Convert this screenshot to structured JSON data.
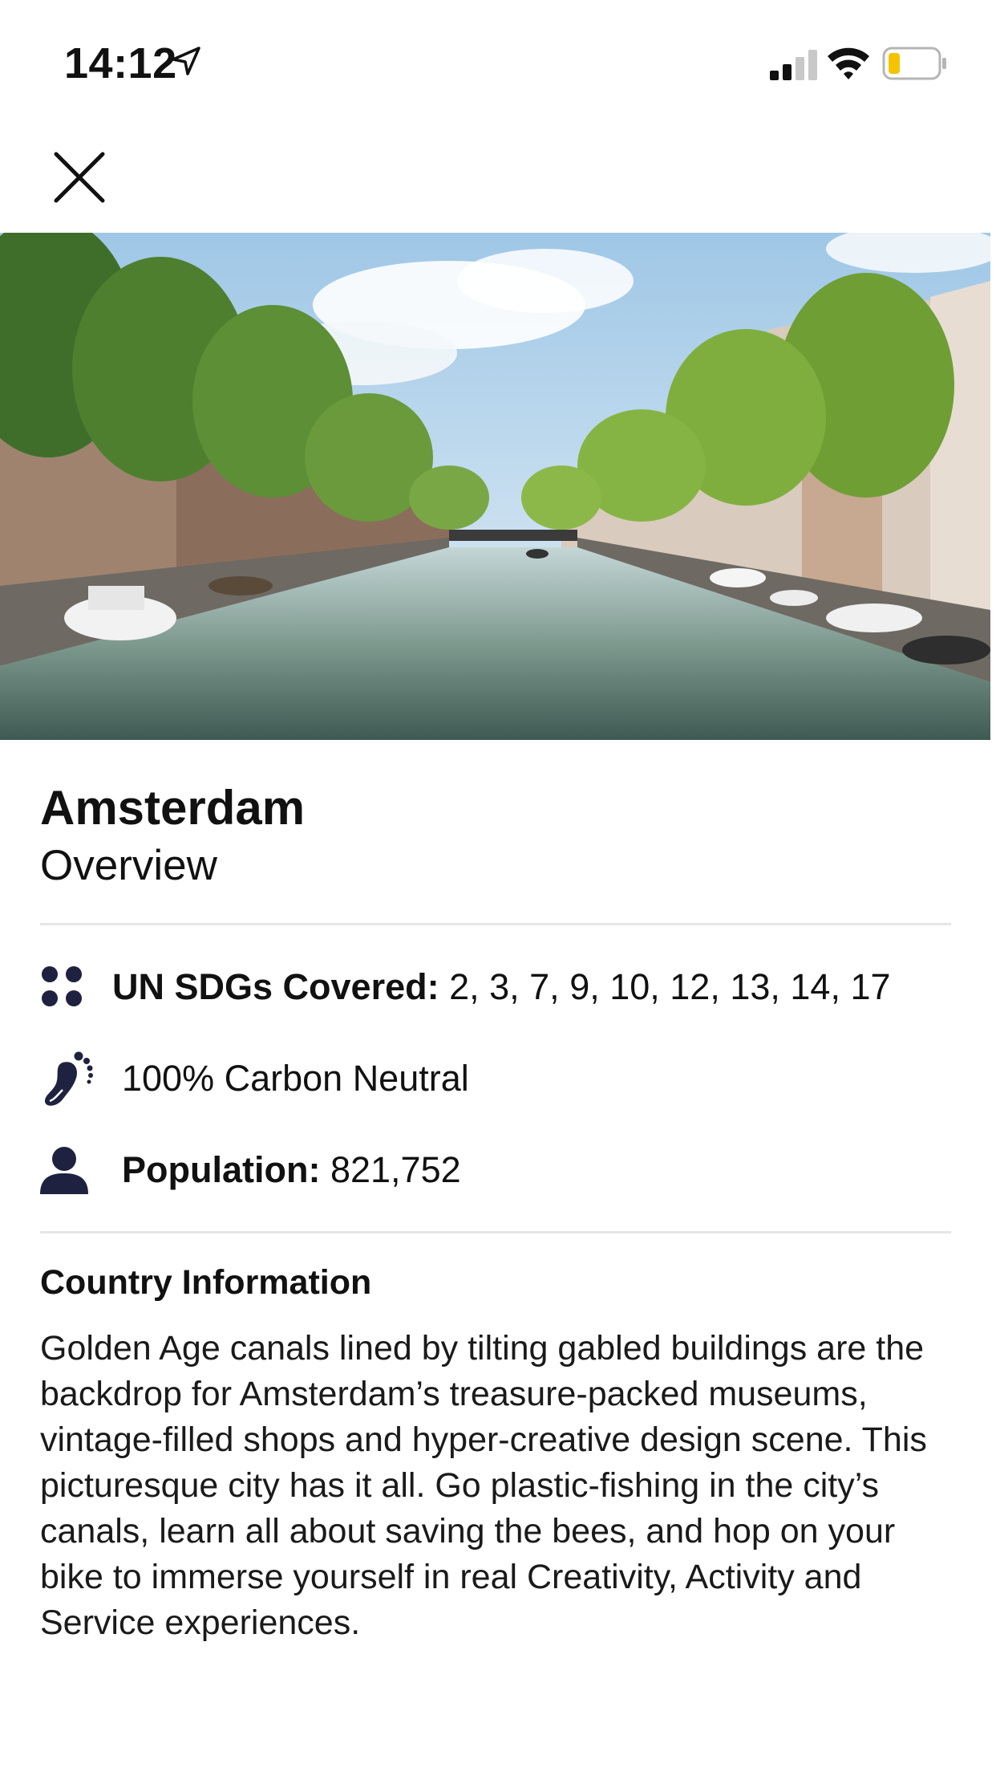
{
  "status_bar": {
    "time": "14:12",
    "icons": [
      "location-arrow-icon",
      "cellular-signal-icon",
      "wifi-icon",
      "battery-low-icon"
    ],
    "battery_color": "#f4c400"
  },
  "nav": {
    "close_icon": "close-icon"
  },
  "hero": {
    "image": "amsterdam-canal-photo"
  },
  "city": {
    "name": "Amsterdam",
    "subtitle": "Overview"
  },
  "info": {
    "sdg_label": "UN SDGs Covered:",
    "sdg_values": " 2, 3, 7, 9, 10, 12, 13, 14, 17",
    "carbon_text": "100% Carbon Neutral",
    "population_label": "Population:",
    "population_value": " 821,752"
  },
  "country_info": {
    "title": "Country Information",
    "description": "Golden Age canals lined by tilting gabled buildings are the backdrop for Amsterdam’s treasure-packed museums, vintage-filled shops and hyper-creative design scene. This picturesque city has it all. Go plastic-fishing in the city’s canals, learn all about saving the bees, and hop on your bike to immerse yourself in real Creativity, Activity and Service experiences."
  },
  "colors": {
    "icon_navy": "#1f2140",
    "divider": "#e6e6e6",
    "text": "#111111"
  }
}
